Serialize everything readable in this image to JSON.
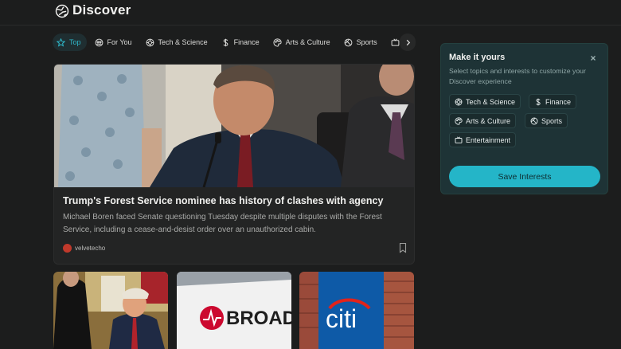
{
  "header": {
    "title": "Discover",
    "logo_icon": "globe-icon"
  },
  "tabs": [
    {
      "label": "Top",
      "icon": "star-icon",
      "active": true
    },
    {
      "label": "For You",
      "icon": "people-icon"
    },
    {
      "label": "Tech & Science",
      "icon": "chip-icon"
    },
    {
      "label": "Finance",
      "icon": "dollar-icon"
    },
    {
      "label": "Arts & Culture",
      "icon": "palette-icon"
    },
    {
      "label": "Sports",
      "icon": "ball-icon"
    }
  ],
  "hero": {
    "title": "Trump's Forest Service nominee has history of clashes with agency",
    "description": "Michael Boren faced Senate questioning Tuesday despite multiple disputes with the Forest Service, including a cease-and-desist order over an unauthorized cabin.",
    "source": "velvetecho"
  },
  "cards": [
    {
      "image": "people-at-desk-photo"
    },
    {
      "image": "broadcom-sign-photo",
      "sign_text": "BROADC"
    },
    {
      "image": "citi-sign-photo",
      "sign_text": "citi"
    }
  ],
  "panel": {
    "title": "Make it yours",
    "subtitle": "Select topics and interests to customize your Discover experience",
    "chips": [
      {
        "label": "Tech & Science",
        "icon": "chip-icon"
      },
      {
        "label": "Finance",
        "icon": "dollar-icon"
      },
      {
        "label": "Arts & Culture",
        "icon": "palette-icon"
      },
      {
        "label": "Sports",
        "icon": "ball-icon"
      },
      {
        "label": "Entertainment",
        "icon": "tv-icon"
      }
    ],
    "save_label": "Save Interests"
  },
  "colors": {
    "accent": "#24b5c8",
    "background": "#1c1d1d",
    "panel": "#1e3336"
  }
}
